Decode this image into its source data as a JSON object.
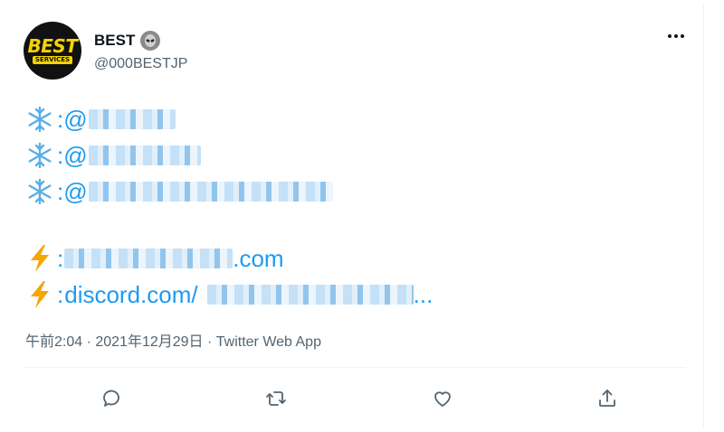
{
  "author": {
    "display_name": "BEST",
    "handle": "@000BESTJP",
    "avatar_text_top": "BEST",
    "avatar_text_bottom": "SERVICES",
    "badge_icon": "alien-icon"
  },
  "tweet": {
    "lines": [
      {
        "emoji": "snowflake-icon",
        "prefix": ":@",
        "text": ""
      },
      {
        "emoji": "snowflake-icon",
        "prefix": ":@",
        "text": ""
      },
      {
        "emoji": "snowflake-icon",
        "prefix": ":@",
        "text": ""
      },
      {
        "emoji": "lightning-icon",
        "prefix": ":",
        "text": ".com"
      },
      {
        "emoji": "lightning-icon",
        "prefix": ":",
        "text": "discord.com/",
        "suffix": "..."
      }
    ]
  },
  "meta": {
    "timestamp": "午前2:04 · 2021年12月29日 · Twitter Web App"
  },
  "actions": {
    "reply_icon": "reply-icon",
    "retweet_icon": "retweet-icon",
    "like_icon": "like-icon",
    "share_icon": "share-icon"
  },
  "colors": {
    "link": "#1d9bf0",
    "text": "#0f1419",
    "secondary": "#536471",
    "snowflake": "#5aaee8",
    "lightning": "#f7a600"
  }
}
